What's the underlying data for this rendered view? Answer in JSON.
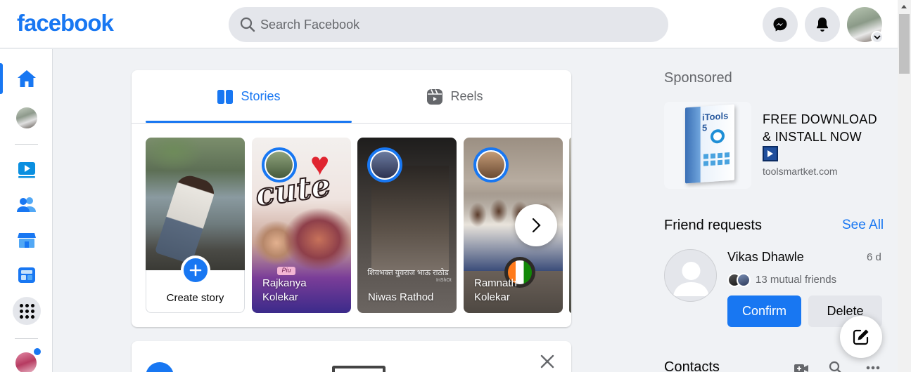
{
  "header": {
    "logo": "facebook",
    "search_placeholder": "Search Facebook",
    "messenger_icon": "messenger-icon",
    "notifications_icon": "bell-icon"
  },
  "leftrail": {
    "items": [
      "home-icon",
      "profile-avatar",
      "watch-icon",
      "friends-icon",
      "marketplace-icon",
      "feeds-icon",
      "menu-icon"
    ]
  },
  "stories": {
    "tabs": [
      {
        "label": "Stories",
        "icon": "stories-icon",
        "active": true
      },
      {
        "label": "Reels",
        "icon": "reels-icon",
        "active": false
      }
    ],
    "create_label": "Create story",
    "items": [
      {
        "name": "Rajkanya Kolekar",
        "sticker_text": "cute",
        "tag": "Piu"
      },
      {
        "name": "Niwas Rathod",
        "overlay_text": "शिवभक्त युवराज भाऊ राठोड",
        "watermark": "InShOt"
      },
      {
        "name": "Ramnath Kolekar"
      }
    ]
  },
  "sponsored": {
    "title": "Sponsored",
    "product_label": "iTools 5",
    "headline": "FREE DOWNLOAD & INSTALL NOW",
    "domain": "toolsmartket.com"
  },
  "friend_requests": {
    "title": "Friend requests",
    "see_all": "See All",
    "request": {
      "name": "Vikas Dhawle",
      "time": "6 d",
      "mutual": "13 mutual friends",
      "confirm_label": "Confirm",
      "delete_label": "Delete"
    }
  },
  "contacts": {
    "title": "Contacts"
  },
  "colors": {
    "brand": "#1877f2",
    "background": "#f0f2f5",
    "secondary_text": "#65676b"
  }
}
